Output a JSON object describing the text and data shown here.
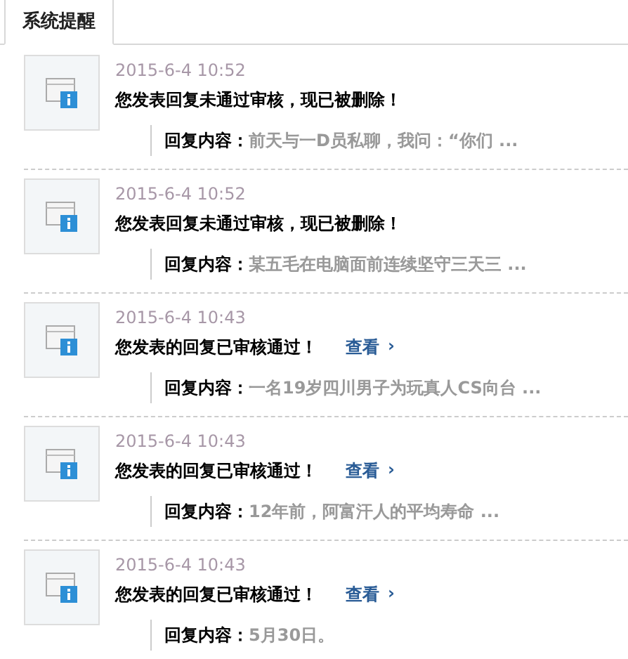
{
  "tabs": [
    {
      "label": "系统提醒",
      "selected": true
    }
  ],
  "notices": [
    {
      "time": "2015-6-4 10:52",
      "title": "您发表回复未通过审核，现已被删除！",
      "reply_label": "回复内容：",
      "reply_text": "前天与一D员私聊，我问：“你们 ..."
    },
    {
      "time": "2015-6-4 10:52",
      "title": "您发表回复未通过审核，现已被删除！",
      "reply_label": "回复内容：",
      "reply_text": "某五毛在电脑面前连续坚守三天三 ..."
    },
    {
      "time": "2015-6-4 10:43",
      "title": "您发表的回复已审核通过！",
      "link": "查看",
      "link_arrow": "›",
      "reply_label": "回复内容：",
      "reply_text": "一名19岁四川男子为玩真人CS向台 ..."
    },
    {
      "time": "2015-6-4 10:43",
      "title": "您发表的回复已审核通过！",
      "link": "查看",
      "link_arrow": "›",
      "reply_label": "回复内容：",
      "reply_text": "12年前，阿富汗人的平均寿命 ..."
    },
    {
      "time": "2015-6-4 10:43",
      "title": "您发表的回复已审核通过！",
      "link": "查看",
      "link_arrow": "›",
      "reply_label": "回复内容：",
      "reply_text": "5月30日。"
    }
  ]
}
